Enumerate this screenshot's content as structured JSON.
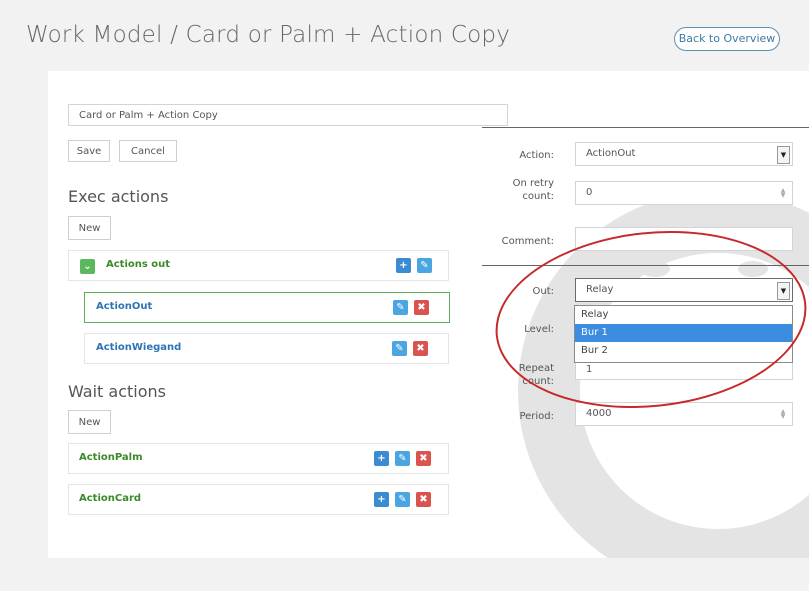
{
  "header": {
    "title": "Work Model / Card or Palm + Action Copy",
    "back_button": "Back to Overview"
  },
  "name_input": {
    "value": "Card or Palm + Action Copy"
  },
  "buttons": {
    "save": "Save",
    "cancel": "Cancel",
    "new_exec": "New",
    "new_wait": "New"
  },
  "exec": {
    "title": "Exec actions",
    "group_label": "Actions out",
    "items": [
      "ActionOut",
      "ActionWiegand"
    ]
  },
  "wait": {
    "title": "Wait actions",
    "items": [
      "ActionPalm",
      "ActionCard"
    ]
  },
  "form": {
    "action_label": "Action:",
    "action_value": "ActionOut",
    "retry_label_1": "On retry",
    "retry_label_2": "count:",
    "retry_value": "0",
    "comment_label": "Comment:",
    "comment_value": "",
    "out_label": "Out:",
    "out_value": "Relay",
    "level_label": "Level:",
    "repeat_label_1": "Repeat",
    "repeat_label_2": "count:",
    "repeat_value": "1",
    "period_label": "Period:",
    "period_value": "4000"
  },
  "out_dropdown": {
    "options": [
      "Relay",
      "Bur 1",
      "Bur 2"
    ],
    "highlighted": "Bur 1"
  },
  "colors": {
    "accent_blue": "#3a8bd1",
    "delete_red": "#d9534f",
    "success_green": "#5cb85c",
    "annotation_red": "#c62a2a"
  }
}
